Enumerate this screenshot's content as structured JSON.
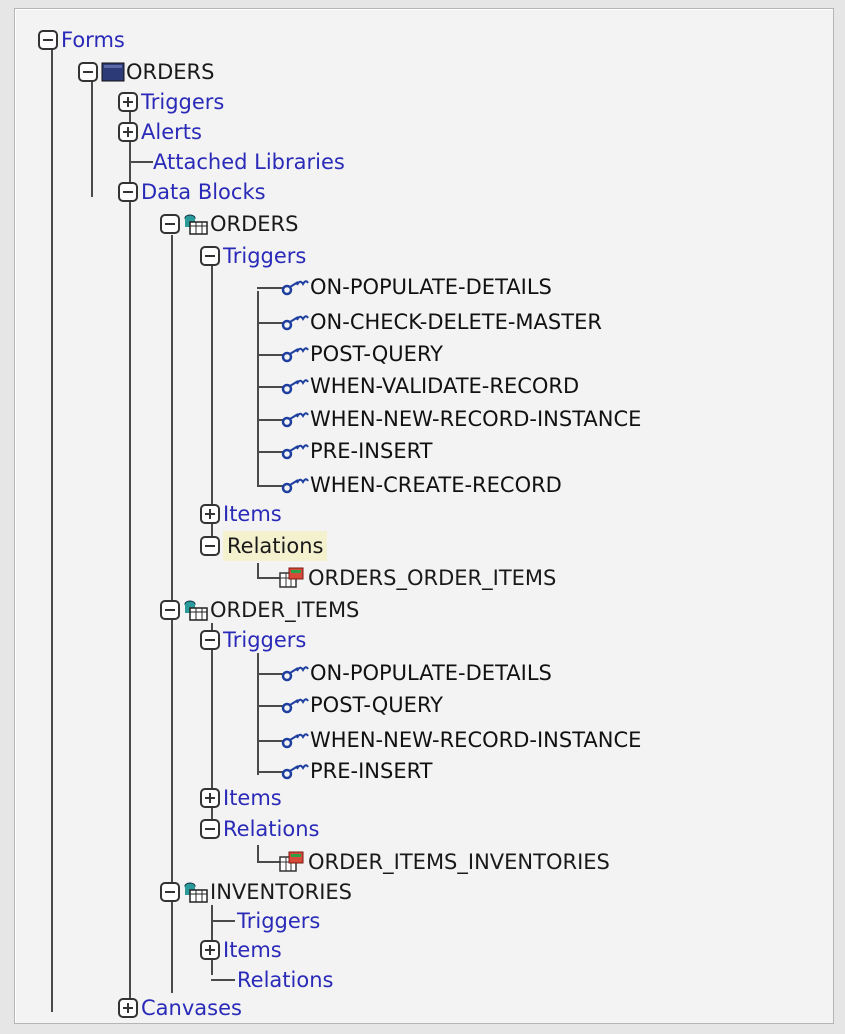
{
  "tree": {
    "forms": {
      "label": "Forms",
      "form": {
        "label": "ORDERS",
        "triggers": "Triggers",
        "alerts": "Alerts",
        "attached_libraries": "Attached Libraries",
        "data_blocks": {
          "label": "Data Blocks",
          "blocks": [
            {
              "name": "ORDERS",
              "triggers_label": "Triggers",
              "triggers": [
                "ON-POPULATE-DETAILS",
                "ON-CHECK-DELETE-MASTER",
                "POST-QUERY",
                "WHEN-VALIDATE-RECORD",
                "WHEN-NEW-RECORD-INSTANCE",
                "PRE-INSERT",
                "WHEN-CREATE-RECORD"
              ],
              "items_label": "Items",
              "relations_label": "Relations",
              "relations": [
                "ORDERS_ORDER_ITEMS"
              ]
            },
            {
              "name": "ORDER_ITEMS",
              "triggers_label": "Triggers",
              "triggers": [
                "ON-POPULATE-DETAILS",
                "POST-QUERY",
                "WHEN-NEW-RECORD-INSTANCE",
                "PRE-INSERT"
              ],
              "items_label": "Items",
              "relations_label": "Relations",
              "relations": [
                "ORDER_ITEMS_INVENTORIES"
              ]
            },
            {
              "name": "INVENTORIES",
              "triggers_label": "Triggers",
              "items_label": "Items",
              "relations_label": "Relations"
            }
          ]
        },
        "canvases": "Canvases"
      }
    }
  },
  "icons": {
    "expand": "plus-box-icon",
    "collapse": "minus-box-icon",
    "form": "form-module-icon",
    "block": "data-block-icon",
    "trigger": "trigger-icon",
    "relation": "relation-icon"
  },
  "colors": {
    "category": "#2a2ab8",
    "object": "#1a1a1a",
    "relation_highlight": "#f4f1cf"
  }
}
